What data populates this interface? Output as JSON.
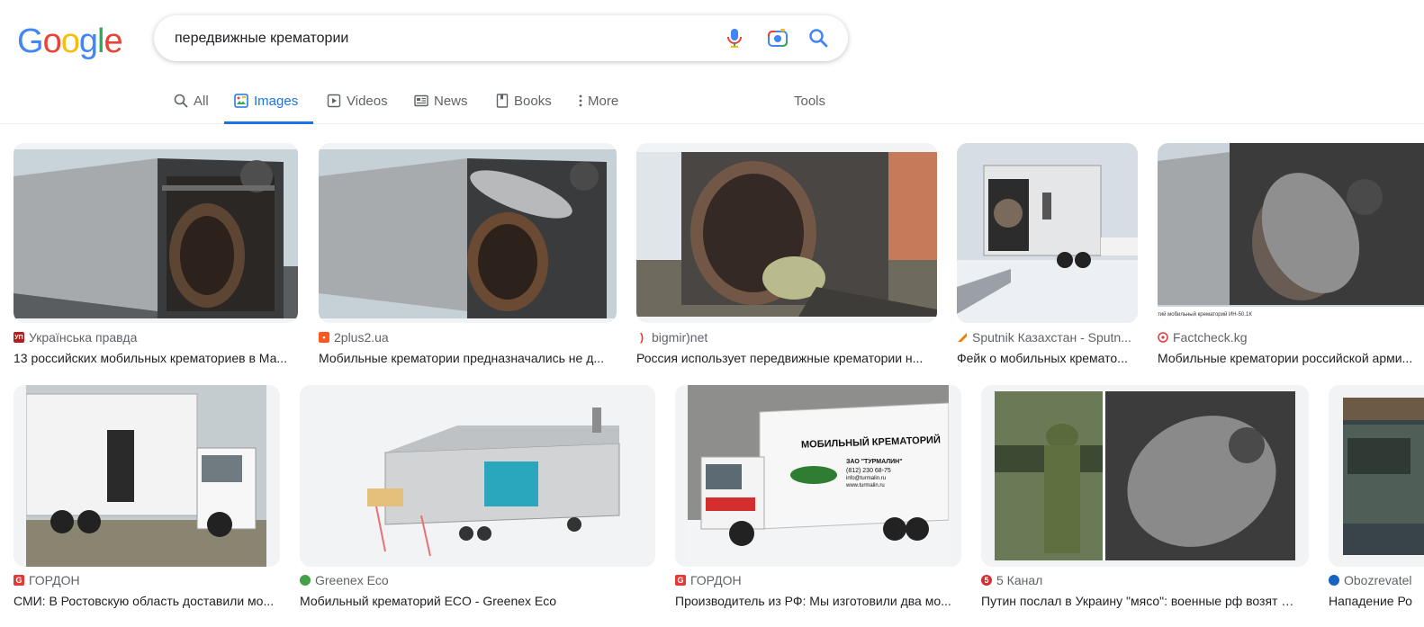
{
  "header": {
    "logo_letters": [
      {
        "ch": "G",
        "color": "#4285F4"
      },
      {
        "ch": "o",
        "color": "#EA4335"
      },
      {
        "ch": "o",
        "color": "#FBBC05"
      },
      {
        "ch": "g",
        "color": "#4285F4"
      },
      {
        "ch": "l",
        "color": "#34A853"
      },
      {
        "ch": "e",
        "color": "#EA4335"
      }
    ],
    "search_query": "передвижные крематории",
    "icons": [
      "microphone-icon",
      "camera-lens-icon",
      "search-icon"
    ]
  },
  "tabs": [
    {
      "label": "All",
      "icon": "search-icon"
    },
    {
      "label": "Images",
      "icon": "image-icon",
      "active": true
    },
    {
      "label": "Videos",
      "icon": "video-icon"
    },
    {
      "label": "News",
      "icon": "news-icon"
    },
    {
      "label": "Books",
      "icon": "book-icon"
    },
    {
      "label": "More",
      "icon": "more-vert-icon"
    },
    {
      "label": "Tools"
    }
  ],
  "results": [
    {
      "source": "Українська правда",
      "title": "13 российских мобильных крематориев в Ма...",
      "fav_color": "#b71c1c",
      "fav_text": "УП"
    },
    {
      "source": "2plus2.ua",
      "title": "Мобильные крематории предназначались не д...",
      "fav_color": "#ff5722",
      "fav_text": "•"
    },
    {
      "source": "bigmir)net",
      "title": "Россия использует передвижные крематории н...",
      "fav_color": "#ffffff",
      "fav_text": ")"
    },
    {
      "source": "Sputnik Казахстан - Sputn...",
      "title": "Фейк о мобильных кремато...",
      "fav_color": "#ffffff",
      "fav_text": ""
    },
    {
      "source": "Factcheck.kg",
      "title": "Мобильные крематории российской арми...",
      "fav_color": "#ffffff",
      "fav_text": ""
    },
    {
      "source": "ГОРДОН",
      "title": "СМИ: В Ростовскую область доставили мо...",
      "fav_color": "#e53935",
      "fav_text": "G"
    },
    {
      "source": "Greenex Eco",
      "title": "Мобильный крематорий ECO - Greenex Eco",
      "fav_color": "#43a047",
      "fav_text": ""
    },
    {
      "source": "ГОРДОН",
      "title": "Производитель из РФ: Мы изготовили два мо...",
      "fav_color": "#e53935",
      "fav_text": "G"
    },
    {
      "source": "5 Канал",
      "title": "Путин послал в Украину \"мясо\": военные рф возят з...",
      "fav_color": "#d32f2f",
      "fav_text": "5"
    },
    {
      "source": "Obozrevatel",
      "title": "Нападение Ро",
      "fav_color": "#1565c0",
      "fav_text": ""
    }
  ],
  "image_text": {
    "truck_banner": "МОБИЛЬНЫЙ КРЕМАТОРИЙ",
    "truck_company": "ЗАО \"ТУРМАЛИН\"",
    "truck_phone": "(812) 230 68-75",
    "truck_email": "info@turmalin.ru",
    "truck_web": "www.turmalin.ru",
    "caption_strip": "тий мобильный крематорий ИН-50.1К"
  }
}
